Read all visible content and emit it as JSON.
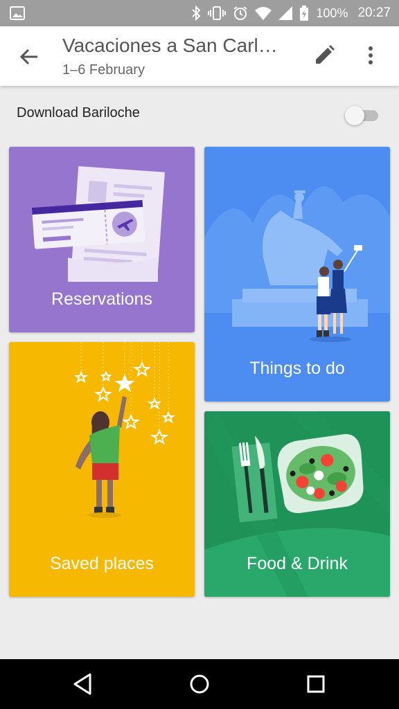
{
  "status_bar": {
    "battery": "100%",
    "time": "20:27",
    "icons": [
      "image-icon",
      "bluetooth-icon",
      "vibrate-icon",
      "alarm-icon",
      "wifi-icon",
      "signal-icon",
      "battery-icon"
    ]
  },
  "app_bar": {
    "title": "Vacaciones a San Carl…",
    "subtitle": "1–6 February",
    "icons": [
      "back-arrow-icon",
      "edit-pencil-icon",
      "more-vert-icon"
    ]
  },
  "download": {
    "label": "Download Bariloche",
    "enabled": false
  },
  "cards": {
    "reservations": {
      "label": "Reservations",
      "color": "#9575cd"
    },
    "things_to_do": {
      "label": "Things to do",
      "color": "#4d8cf1"
    },
    "saved_places": {
      "label": "Saved places",
      "color": "#f6b800"
    },
    "food_drink": {
      "label": "Food & Drink",
      "color": "#1f9257"
    }
  },
  "nav_bar": {
    "icons": [
      "back-triangle-icon",
      "home-circle-icon",
      "recents-square-icon"
    ]
  }
}
